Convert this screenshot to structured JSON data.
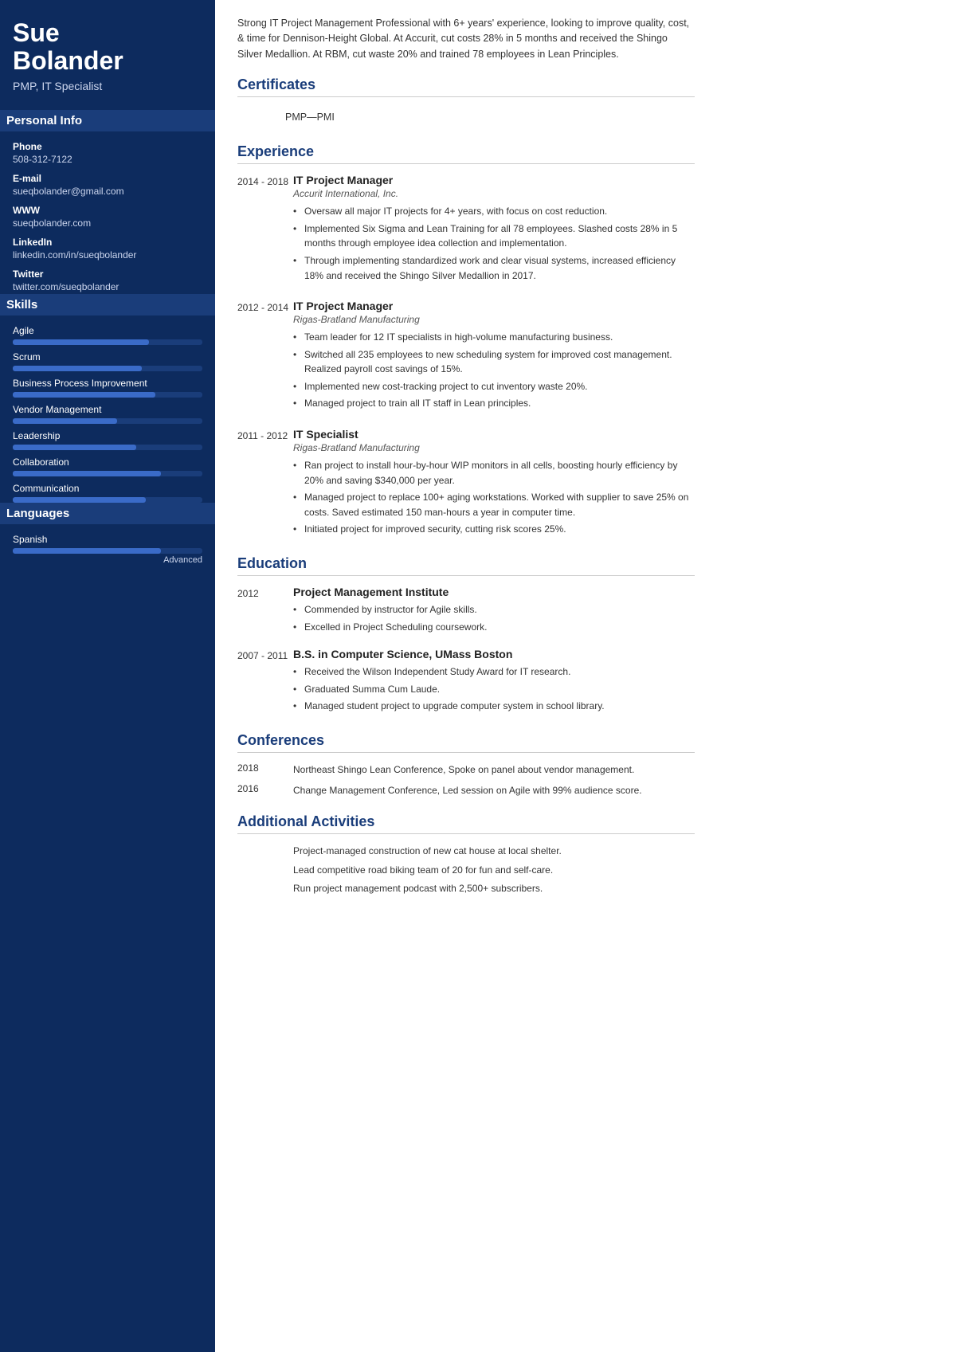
{
  "sidebar": {
    "name_line1": "Sue",
    "name_line2": "Bolander",
    "title": "PMP, IT Specialist",
    "sections": {
      "personal_info": "Personal Info",
      "skills": "Skills",
      "languages": "Languages"
    },
    "contacts": [
      {
        "label": "Phone",
        "value": "508-312-7122"
      },
      {
        "label": "E-mail",
        "value": "sueqbolander@gmail.com"
      },
      {
        "label": "WWW",
        "value": "sueqbolander.com"
      },
      {
        "label": "LinkedIn",
        "value": "linkedin.com/in/sueqbolander"
      },
      {
        "label": "Twitter",
        "value": "twitter.com/sueqbolander"
      }
    ],
    "skills": [
      {
        "name": "Agile",
        "pct": 72
      },
      {
        "name": "Scrum",
        "pct": 68
      },
      {
        "name": "Business Process Improvement",
        "pct": 75
      },
      {
        "name": "Vendor Management",
        "pct": 55
      },
      {
        "name": "Leadership",
        "pct": 65
      },
      {
        "name": "Collaboration",
        "pct": 78
      },
      {
        "name": "Communication",
        "pct": 70
      }
    ],
    "languages": [
      {
        "name": "Spanish",
        "pct": 78,
        "level": "Advanced"
      }
    ]
  },
  "main": {
    "summary": "Strong IT Project Management Professional with 6+ years' experience, looking to improve quality, cost, & time for Dennison-Height Global. At Accurit, cut costs 28% in 5 months and received the Shingo Silver Medallion. At RBM, cut waste 20% and trained 78 employees in Lean Principles.",
    "sections": {
      "certificates": "Certificates",
      "experience": "Experience",
      "education": "Education",
      "conferences": "Conferences",
      "additional": "Additional Activities"
    },
    "certificates": [
      {
        "text": "PMP—PMI"
      }
    ],
    "experience": [
      {
        "dates": "2014 - 2018",
        "title": "IT Project Manager",
        "company": "Accurit International, Inc.",
        "bullets": [
          "Oversaw all major IT projects for 4+ years, with focus on cost reduction.",
          "Implemented Six Sigma and Lean Training for all 78 employees. Slashed costs 28% in 5 months through employee idea collection and implementation.",
          "Through implementing standardized work and clear visual systems, increased efficiency 18% and received the Shingo Silver Medallion in 2017."
        ]
      },
      {
        "dates": "2012 - 2014",
        "title": "IT Project Manager",
        "company": "Rigas-Bratland Manufacturing",
        "bullets": [
          "Team leader for 12 IT specialists in high-volume manufacturing business.",
          "Switched all 235 employees to new scheduling system for improved cost management. Realized payroll cost savings of 15%.",
          "Implemented new cost-tracking project to cut inventory waste 20%.",
          "Managed project to train all IT staff in Lean principles."
        ]
      },
      {
        "dates": "2011 - 2012",
        "title": "IT Specialist",
        "company": "Rigas-Bratland Manufacturing",
        "bullets": [
          "Ran project to install hour-by-hour WIP monitors in all cells, boosting hourly efficiency by 20% and saving $340,000 per year.",
          "Managed project to replace 100+ aging workstations. Worked with supplier to save 25% on costs. Saved estimated 150 man-hours a year in computer time.",
          "Initiated project for improved security, cutting risk scores 25%."
        ]
      }
    ],
    "education": [
      {
        "dates": "2012",
        "institution": "Project Management Institute",
        "bullets": [
          "Commended by instructor for Agile skills.",
          "Excelled in Project Scheduling coursework."
        ]
      },
      {
        "dates": "2007 - 2011",
        "institution": "B.S. in Computer Science, UMass Boston",
        "bullets": [
          "Received the Wilson Independent Study Award for IT research.",
          "Graduated Summa Cum Laude.",
          "Managed student project to upgrade computer system in school library."
        ]
      }
    ],
    "conferences": [
      {
        "year": "2018",
        "text": "Northeast Shingo Lean Conference, Spoke on panel about vendor management."
      },
      {
        "year": "2016",
        "text": "Change Management Conference, Led session on Agile with 99% audience score."
      }
    ],
    "activities": [
      "Project-managed construction of new cat house at local shelter.",
      "Lead competitive road biking team of 20 for fun and self-care.",
      "Run project management podcast with 2,500+ subscribers."
    ]
  }
}
